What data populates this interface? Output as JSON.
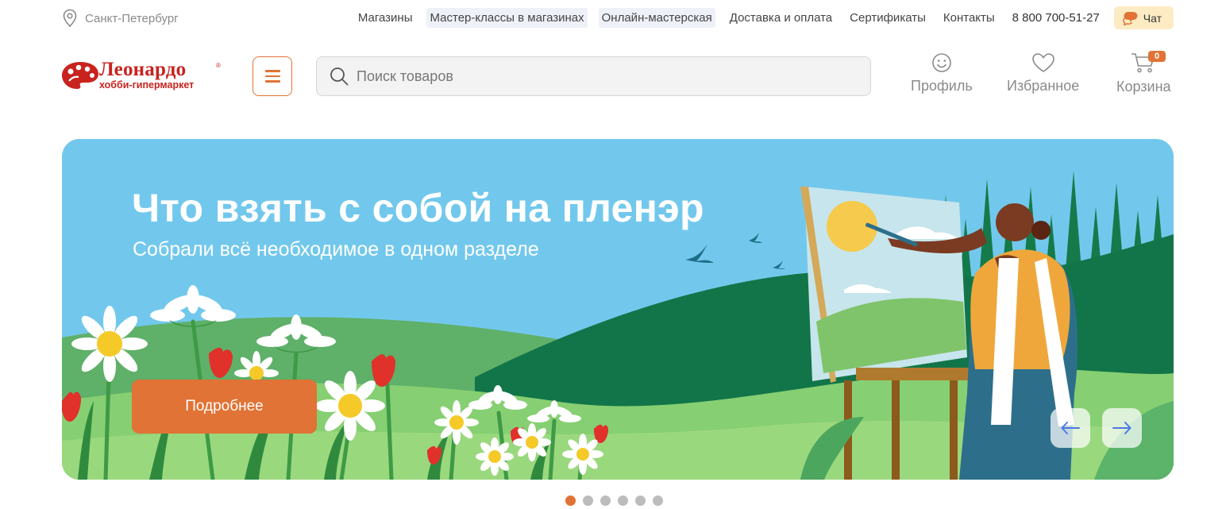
{
  "topbar": {
    "city": "Санкт-Петербург",
    "links": [
      {
        "label": "Магазины"
      },
      {
        "label": "Мастер-классы в магазинах"
      },
      {
        "label": "Онлайн-мастерская"
      },
      {
        "label": "Доставка и оплата"
      },
      {
        "label": "Сертификаты"
      },
      {
        "label": "Контакты"
      }
    ],
    "phone": "8 800 700-51-27",
    "chat_label": "Чат"
  },
  "header": {
    "logo_title": "Леонардо",
    "logo_subtitle": "хобби-гипермаркет",
    "logo_reg": "®",
    "search_placeholder": "Поиск товаров",
    "profile_label": "Профиль",
    "favorites_label": "Избранное",
    "cart_label": "Корзина",
    "cart_count": "0"
  },
  "banner": {
    "title": "Что взять с собой на пленэр",
    "subtitle": "Собрали всё необходимое в одном разделе",
    "button_label": "Подробнее",
    "total_slides": 6,
    "active_slide": 1
  },
  "colors": {
    "accent": "#e07335",
    "brand_red": "#c8231f",
    "sky": "#72c8ec"
  },
  "icons": [
    "location-pin-icon",
    "chat-bubble-icon",
    "menu-icon",
    "search-icon",
    "smiley-icon",
    "heart-icon",
    "cart-icon",
    "arrow-left-icon",
    "arrow-right-icon"
  ]
}
